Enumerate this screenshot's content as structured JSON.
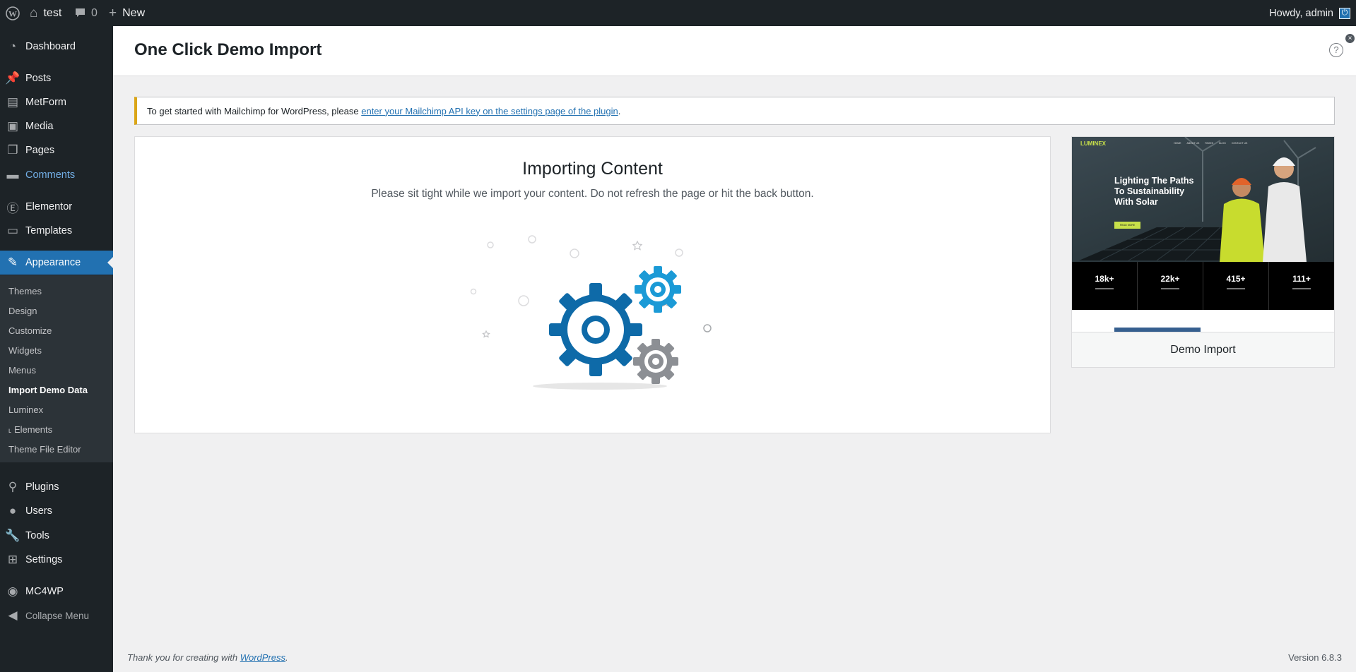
{
  "admin_bar": {
    "site_name": "test",
    "comments_count": "0",
    "new_label": "New",
    "howdy": "Howdy, admin"
  },
  "sidebar": {
    "items": [
      {
        "label": "Dashboard",
        "icon": "dashboard-icon"
      },
      {
        "label": "Posts",
        "icon": "pin-icon"
      },
      {
        "label": "MetForm",
        "icon": "form-icon"
      },
      {
        "label": "Media",
        "icon": "media-icon"
      },
      {
        "label": "Pages",
        "icon": "pages-icon"
      },
      {
        "label": "Comments",
        "icon": "comment-icon"
      },
      {
        "label": "Elementor",
        "icon": "elementor-icon"
      },
      {
        "label": "Templates",
        "icon": "folder-icon"
      },
      {
        "label": "Appearance",
        "icon": "paintbrush-icon"
      },
      {
        "label": "Plugins",
        "icon": "plugin-icon"
      },
      {
        "label": "Users",
        "icon": "user-icon"
      },
      {
        "label": "Tools",
        "icon": "wrench-icon"
      },
      {
        "label": "Settings",
        "icon": "settings-icon"
      },
      {
        "label": "MC4WP",
        "icon": "mailchimp-icon"
      },
      {
        "label": "Collapse Menu",
        "icon": "collapse-icon"
      }
    ],
    "submenu": [
      "Themes",
      "Design",
      "Customize",
      "Widgets",
      "Menus",
      "Import Demo Data",
      "Luminex",
      "˪ Elements",
      "Theme File Editor"
    ]
  },
  "header": {
    "title": "One Click Demo Import"
  },
  "notice": {
    "text": "To get started with Mailchimp for WordPress, please ",
    "link": "enter your Mailchimp API key on the settings page of the plugin",
    "end": "."
  },
  "import": {
    "title": "Importing Content",
    "description": "Please sit tight while we import your content. Do not refresh the page or hit the back button."
  },
  "preview": {
    "brand": "LUMINEX",
    "nav": [
      "HOME",
      "ABOUT US",
      "PAGES",
      "BLOG",
      "CONTACT US"
    ],
    "headline_1": "Lighting The Paths",
    "headline_2": "To Sustainability",
    "headline_3": "With Solar",
    "button": "READ MORE",
    "stats": [
      "18k+",
      "22k+",
      "415+",
      "111+"
    ],
    "progress": 0.33,
    "card_label": "Demo Import"
  },
  "footer": {
    "thanks": "Thank you for creating with ",
    "link": "WordPress",
    "end": ".",
    "version": "Version 6.8.3"
  },
  "colors": {
    "admin_dark": "#1d2327",
    "accent_blue": "#2271b1",
    "gear_blue": "#0e6aa8",
    "gear_light_blue": "#1b9ad6",
    "gear_gray": "#8c8f94",
    "notice_yellow": "#dba617"
  }
}
